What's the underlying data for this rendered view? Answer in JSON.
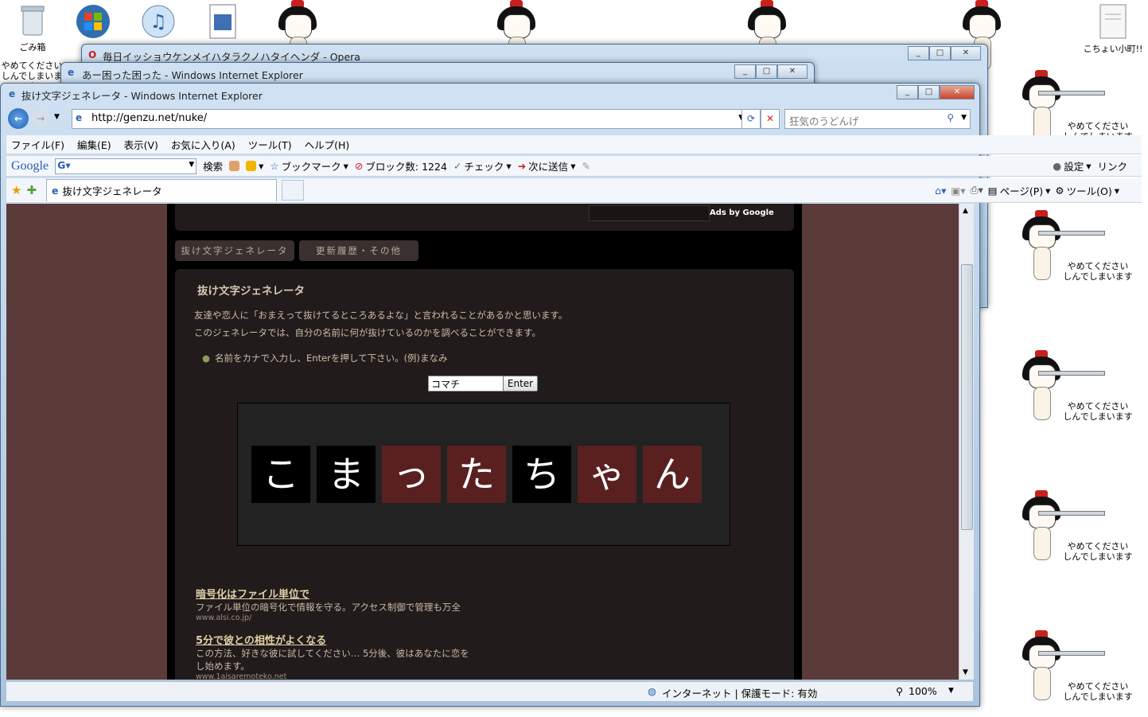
{
  "desktop": {
    "icons": [
      {
        "name": "recycle-bin",
        "label": "ごみ箱"
      },
      {
        "name": "start-orb",
        "label": ""
      },
      {
        "name": "music-player",
        "label": ""
      },
      {
        "name": "document-file",
        "label": ""
      },
      {
        "name": "text-file",
        "label": "こちょい小町!!"
      }
    ],
    "wallpaper_caption": [
      "やめてください",
      "しんでしまいます"
    ]
  },
  "windows": {
    "opera_title": "毎日イッショウケンメイハタラクノハタイヘンダ - Opera",
    "ie_back_title": "あー困った困った - Windows Internet Explorer",
    "ie_main_title": "抜け文字ジェネレータ - Windows Internet Explorer"
  },
  "address": {
    "url": "http://genzu.net/nuke/",
    "search_placeholder": "狂気のうどんげ"
  },
  "menu": [
    "ファイル(F)",
    "編集(E)",
    "表示(V)",
    "お気に入り(A)",
    "ツール(T)",
    "ヘルプ(H)"
  ],
  "google_bar": {
    "logo": "Google",
    "search_btn": "検索",
    "bookmark": "ブックマーク",
    "blocked": "ブロック数: 1224",
    "check": "チェック",
    "send": "次に送信",
    "settings": "設定",
    "links": "リンク"
  },
  "tab": {
    "label": "抜け文字ジェネレータ"
  },
  "cmdbar": {
    "page": "ページ(P)",
    "tools": "ツール(O)"
  },
  "page": {
    "ads_by": "Ads by Google",
    "nav": [
      "抜け文字ジェネレータ",
      "更新履歴・その他"
    ],
    "title": "抜け文字ジェネレータ",
    "intro1": "友達や恋人に「おまえって抜けてるところあるよな」と言われることがあるかと思います。",
    "intro2": "このジェネレータでは、自分の名前に何が抜けているのかを調べることができます。",
    "bullet": "名前をカナで入力し、Enterを押して下さい。(例)まなみ",
    "input_value": "コマチ",
    "enter_label": "Enter",
    "result": [
      {
        "ch": "こ",
        "hit": true
      },
      {
        "ch": "ま",
        "hit": true
      },
      {
        "ch": "っ",
        "hit": false
      },
      {
        "ch": "た",
        "hit": false
      },
      {
        "ch": "ち",
        "hit": true
      },
      {
        "ch": "ゃ",
        "hit": false
      },
      {
        "ch": "ん",
        "hit": false
      }
    ],
    "ads": [
      {
        "title": "暗号化はファイル単位で",
        "desc": "ファイル単位の暗号化で情報を守る。アクセス制御で管理も万全",
        "url": "www.alsi.co.jp/"
      },
      {
        "title": "5分で彼との相性がよくなる",
        "desc": "この方法、好きな彼に試してください… 5分後、彼はあなたに恋を",
        "desc2": "し始めます。",
        "url": "www.1aisaremoteko.net"
      }
    ]
  },
  "status": {
    "zone": "インターネット | 保護モード: 有効",
    "zoom": "100%"
  },
  "colors": {
    "tile_hit": "#000000",
    "tile_miss": "#5a2020",
    "page_bg": "#5b3a3a"
  }
}
